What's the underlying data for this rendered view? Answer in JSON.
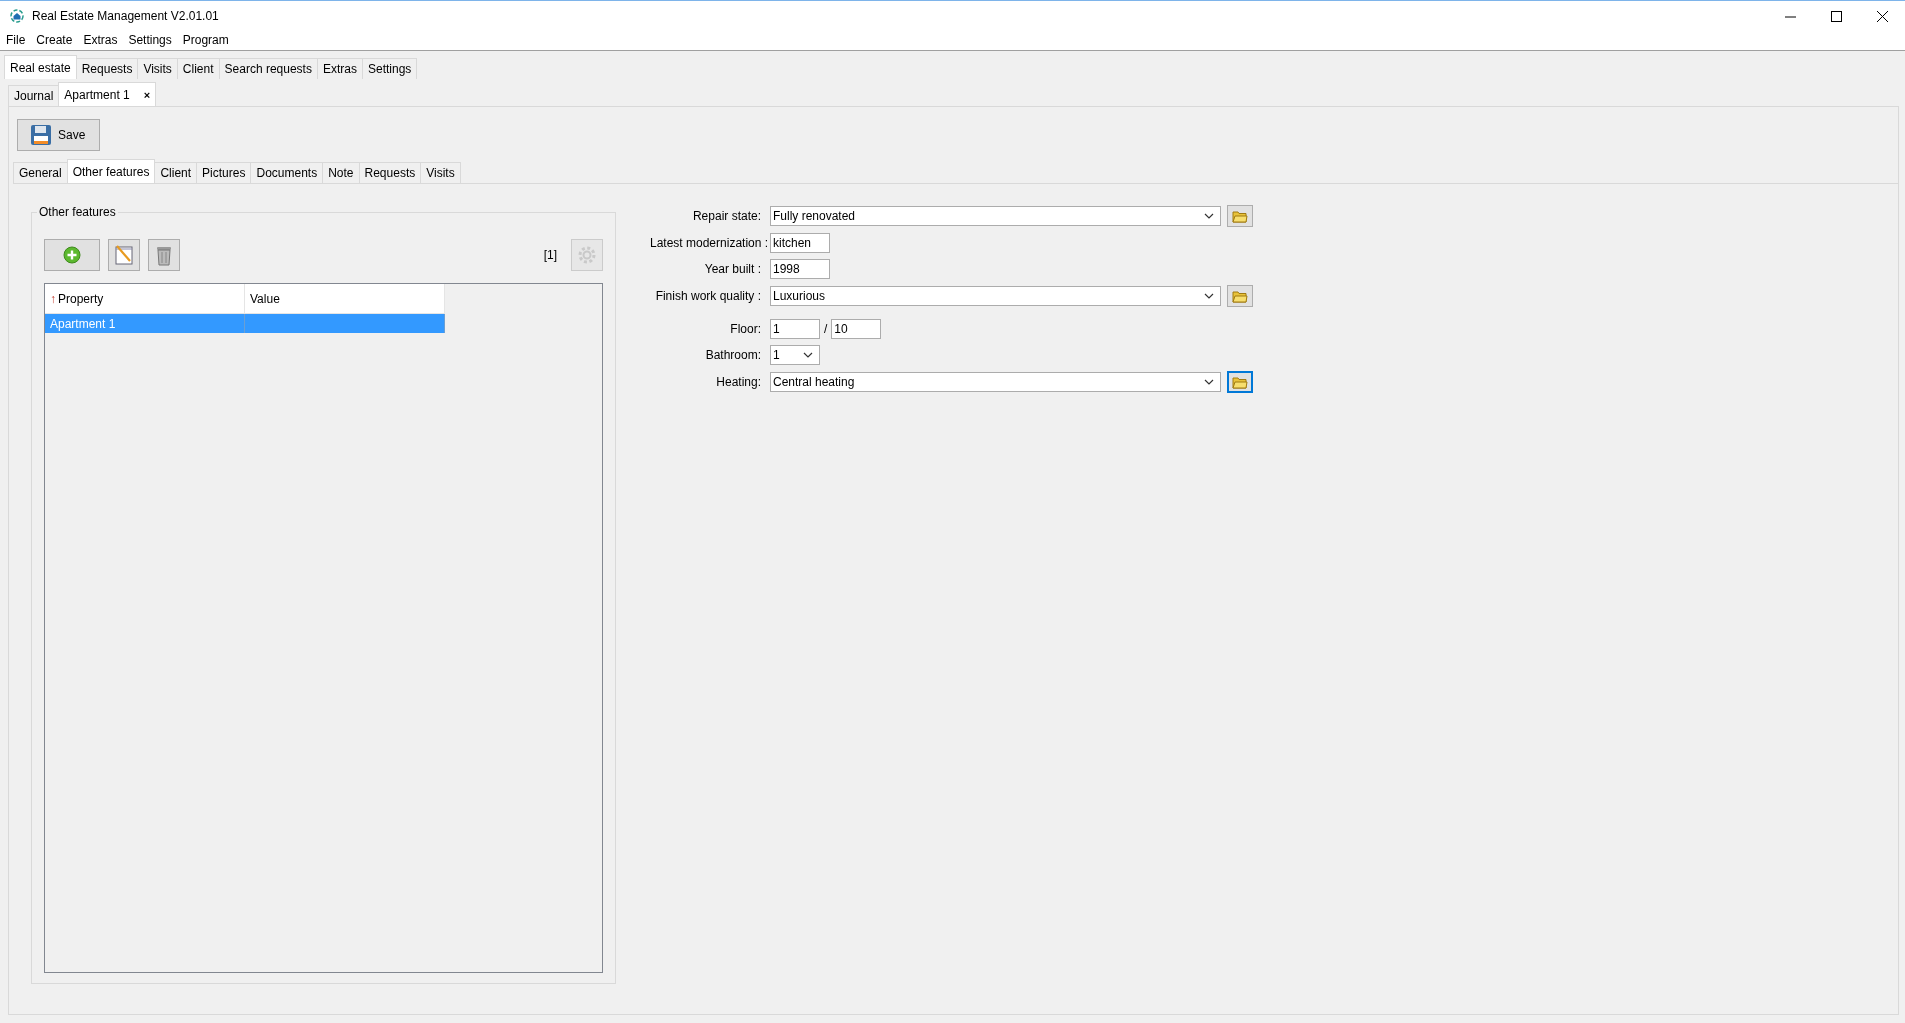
{
  "window": {
    "title": "Real Estate Management V2.01.01"
  },
  "menu": [
    "File",
    "Create",
    "Extras",
    "Settings",
    "Program"
  ],
  "main_tabs": [
    {
      "label": "Real estate",
      "selected": true
    },
    {
      "label": "Requests",
      "selected": false
    },
    {
      "label": "Visits",
      "selected": false
    },
    {
      "label": "Client",
      "selected": false
    },
    {
      "label": "Search requests",
      "selected": false
    },
    {
      "label": "Extras",
      "selected": false
    },
    {
      "label": "Settings",
      "selected": false
    }
  ],
  "document_tabs": [
    {
      "label": "Journal",
      "selected": false,
      "closable": false
    },
    {
      "label": "Apartment 1",
      "selected": true,
      "closable": true,
      "close": "×"
    }
  ],
  "save_button": {
    "label": "Save"
  },
  "detail_tabs": [
    {
      "label": "General",
      "selected": false
    },
    {
      "label": "Other features",
      "selected": true
    },
    {
      "label": "Client",
      "selected": false
    },
    {
      "label": "Pictures",
      "selected": false
    },
    {
      "label": "Documents",
      "selected": false
    },
    {
      "label": "Note",
      "selected": false
    },
    {
      "label": "Requests",
      "selected": false
    },
    {
      "label": "Visits",
      "selected": false
    }
  ],
  "features": {
    "title": "Other features",
    "count": "[1]",
    "settings_disabled": true,
    "table": {
      "sort_arrow": "↑",
      "columns": [
        "Property",
        "Value"
      ],
      "rows": [
        {
          "cells": [
            "Apartment 1",
            ""
          ],
          "selected": true
        }
      ]
    }
  },
  "form": [
    {
      "kind": "combo",
      "label": "Repair state:",
      "value": "Fully renovated",
      "focused": false
    },
    {
      "kind": "text",
      "label": "Latest modernization :",
      "value": "kitchen"
    },
    {
      "kind": "text",
      "label": "Year built :",
      "value": "1998"
    },
    {
      "kind": "combo",
      "label": "Finish work quality :",
      "value": "Luxurious",
      "focused": false
    },
    {
      "kind": "pair",
      "label": "Floor:",
      "value": "1",
      "separator": "/",
      "value2": "10"
    },
    {
      "kind": "small_combo",
      "label": "Bathroom:",
      "value": "1"
    },
    {
      "kind": "combo",
      "label": "Heating:",
      "value": "Central heating",
      "focused": true
    }
  ]
}
